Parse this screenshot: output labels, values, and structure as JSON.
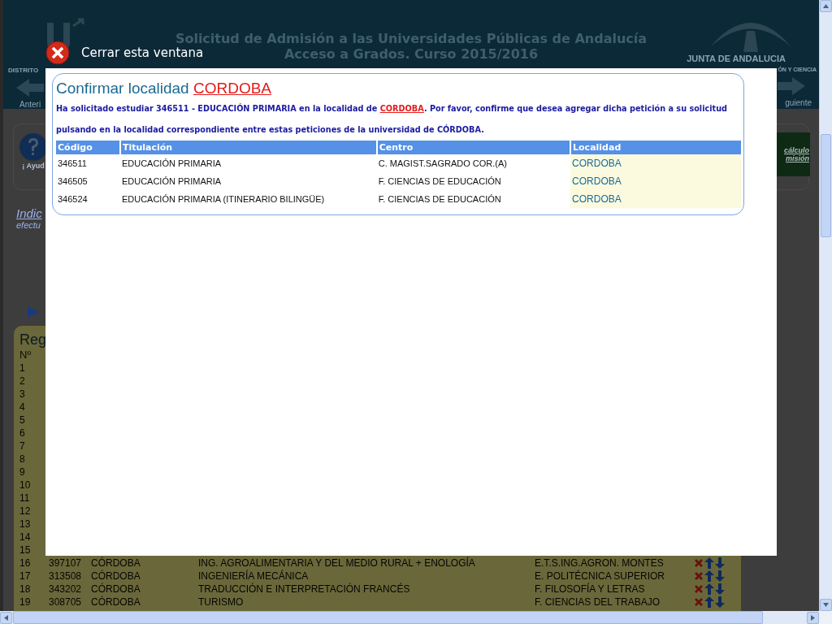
{
  "header": {
    "title_lines": [
      "Solicitud de Admisión a las Universidades Públicas de Andalucía",
      "Acceso a Grados. Curso 2015/2016"
    ],
    "logo_text": "JUNTA DE ANDALUCIA",
    "nav_left": "DISTRITO",
    "nav_right": "ÓN Y CIENCIA",
    "prev_label": "Anteri",
    "next_label": "guiente"
  },
  "help": {
    "label": "¡ Ayud"
  },
  "intro": {
    "link": "Indic",
    "text": "efectu"
  },
  "calc_button": [
    "cálculo",
    "misión"
  ],
  "requests": {
    "title": "Reg",
    "number_heading": "Nº",
    "rows": [
      {
        "n": "1"
      },
      {
        "n": "2"
      },
      {
        "n": "3"
      },
      {
        "n": "4"
      },
      {
        "n": "5"
      },
      {
        "n": "6"
      },
      {
        "n": "7"
      },
      {
        "n": "8"
      },
      {
        "n": "9"
      },
      {
        "n": "10"
      },
      {
        "n": "11"
      },
      {
        "n": "12"
      },
      {
        "n": "13"
      },
      {
        "n": "14"
      },
      {
        "n": "15"
      },
      {
        "n": "16",
        "code": "397107",
        "city": "CÓRDOBA",
        "degree": "ING. AGROALIMENTARIA Y DEL MEDIO RURAL + ENOLOGÍA",
        "center": "E.T.S.ING.AGRON. MONTES"
      },
      {
        "n": "17",
        "code": "313508",
        "city": "CÓRDOBA",
        "degree": "INGENIERÍA MECÁNICA",
        "center": "E. POLITÉCNICA SUPERIOR"
      },
      {
        "n": "18",
        "code": "343202",
        "city": "CÓRDOBA",
        "degree": "TRADUCCIÓN E INTERPRETACIÓN FRANCÉS",
        "center": "F. FILOSOFÍA Y LETRAS"
      },
      {
        "n": "19",
        "code": "308705",
        "city": "CÓRDOBA",
        "degree": "TURISMO",
        "center": "F. CIENCIAS DEL TRABAJO"
      }
    ]
  },
  "modal": {
    "close_label": "Cerrar esta ventana",
    "title": "Confirmar localidad",
    "title_place": "CORDOBA",
    "message": [
      {
        "kind": "text",
        "text": "Ha solicitado estudiar 346511 - EDUCACIÓN PRIMARIA en la localidad de "
      },
      {
        "kind": "link",
        "text": "CORDOBA"
      },
      {
        "kind": "text",
        "text": ". Por favor, confirme que desea agregar dicha petición a su solicitud pulsando en la localidad correspondiente entre estas peticiones de la universidad de CÓRDOBA."
      }
    ],
    "columns": [
      "Código",
      "Titulación",
      "Centro",
      "Localidad"
    ],
    "rows": [
      [
        "346511",
        "EDUCACIÓN PRIMARIA",
        "C. MAGIST.SAGRADO COR.(A)",
        "CORDOBA"
      ],
      [
        "346505",
        "EDUCACIÓN PRIMARIA",
        "F. CIENCIAS DE EDUCACIÓN",
        "CORDOBA"
      ],
      [
        "346524",
        "EDUCACIÓN PRIMARIA (ITINERARIO BILINGÜE)",
        "F. CIENCIAS DE EDUCACIÓN",
        "CORDOBA"
      ]
    ]
  }
}
